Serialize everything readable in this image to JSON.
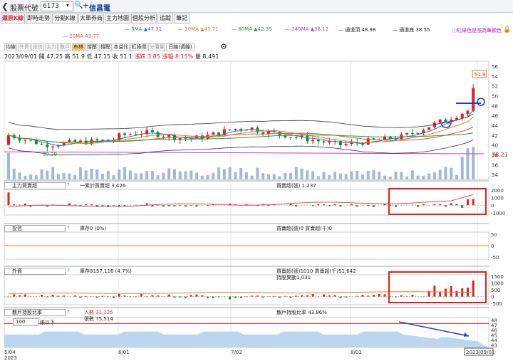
{
  "topbar": {
    "back_icon": "chevron-left-icon",
    "stock_label": "股票代號",
    "stock_code": "6173",
    "stock_name": "信昌電"
  },
  "tabs": [
    "還原K線",
    "即時走勢",
    "分點K線",
    "大單券商",
    "主力地圖",
    "個股分析",
    "追蹤",
    "筆記"
  ],
  "active_tab": 0,
  "ma_legend": [
    {
      "label": "20MA 43.77",
      "color": "#e05050"
    },
    {
      "label": "5MA ▲47.31",
      "color": "#2a6fd6"
    },
    {
      "label": "10MA ▲45.71",
      "color": "#e08020"
    },
    {
      "label": "60MA ▲42.35",
      "color": "#28a028"
    },
    {
      "label": "240MA ▲38.12",
      "color": "#c040c0"
    },
    {
      "label": "通道頂 48.98",
      "color": "#222222"
    },
    {
      "label": "通道底 38.55",
      "color": "#222222"
    }
  ],
  "link_text": "紅綠色是漲為華顯色",
  "toolbar": [
    "均線",
    "外資",
    "投信",
    "主力",
    "散戶",
    "布林",
    "撐壓",
    "撐壓",
    "本益比",
    "紅綠燈",
    "分價量",
    "日線(週線)"
  ],
  "ohlc": {
    "date": "2023/09/01",
    "open": "開 47.25",
    "high": "高 51.9",
    "low": "低 47.15",
    "close": "收 51.1",
    "change": "漲跌 3.85",
    "pct": "漲幅 8.15%",
    "volume": "量 8,491"
  },
  "price_axis": [
    "56",
    "54",
    "52",
    "50",
    "48",
    "46",
    "44",
    "42",
    "40",
    "38",
    "36",
    "34"
  ],
  "labels": {
    "peak": "51.9",
    "low": "39.39",
    "right_price": "38.21"
  },
  "panel1": {
    "select": "主力買賣超",
    "q": "?",
    "legend1": "一累計買賣超 3,426",
    "legend2": "買賣超(張) 1,237",
    "axis": [
      "2000",
      "1000",
      "0",
      "-1000"
    ]
  },
  "panel2": {
    "select": "投信",
    "q": "?",
    "legend1": "庫存0 (0%)",
    "legend2": "買賣超(張)0 買賣超(千)0",
    "axis": [
      "50",
      "0",
      "-50"
    ]
  },
  "panel3": {
    "select": "外資",
    "q": "?",
    "legend1": "庫存8157,116 (4.7%)",
    "legend2": "買賣超(張)1010 買賣超(千)51,642",
    "legend3": "持股異動1,031",
    "axis": [
      "1500",
      "1000",
      "500",
      "0",
      "-500"
    ]
  },
  "panel4": {
    "select": "散戶持股比率",
    "q": "?",
    "count_select": "100",
    "count_suffix": "張以下",
    "legend1": "人數 31,125",
    "legend2": "張數 75,514",
    "legend3": "散戶持股比率 43.86%",
    "axis": [
      "48",
      "47",
      "46",
      "45",
      "44",
      "43"
    ]
  },
  "x_axis": [
    "5/04\n2023",
    "6/01",
    "7/03",
    "8/01",
    "2023/09/01"
  ],
  "colors": {
    "up": "#e02020",
    "down": "#109020",
    "vol": "#88a8d0",
    "highlight": "#e02020",
    "arrow": "#1b3fd0"
  }
}
